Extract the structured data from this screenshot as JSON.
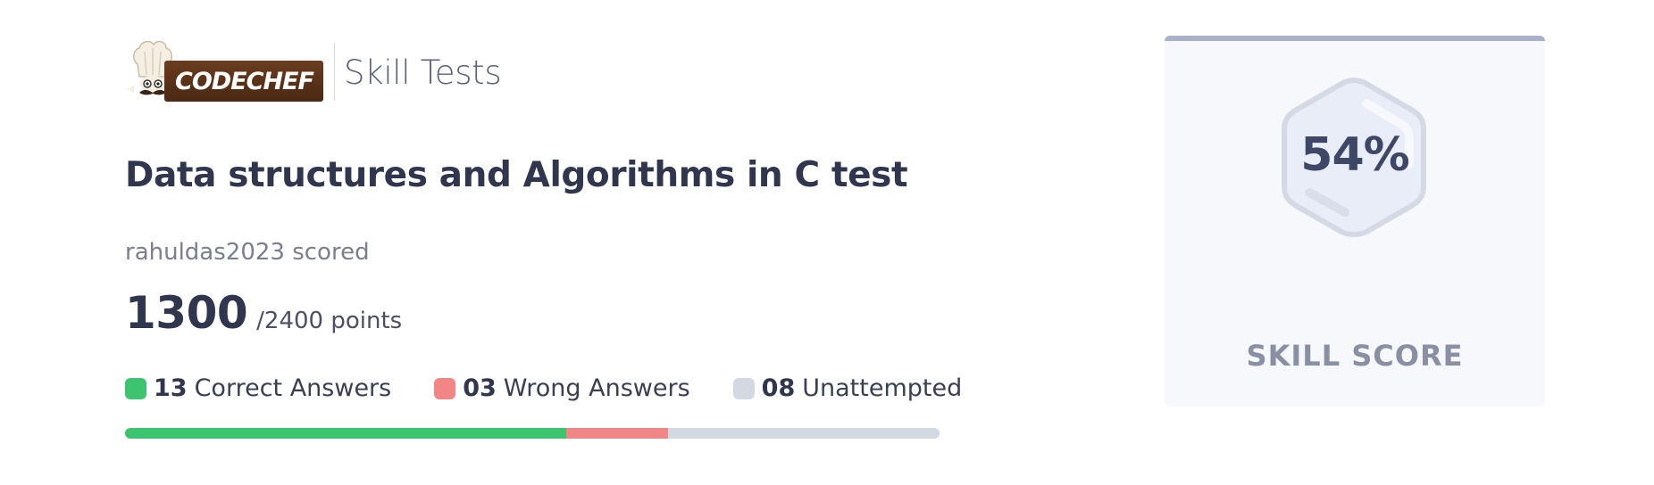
{
  "brand": {
    "logo_text": "CODECHEF",
    "product_name": "Skill Tests"
  },
  "test": {
    "title": "Data structures and Algorithms in C test",
    "scored_text": "rahuldas2023 scored",
    "score": "1300",
    "total": "/2400 points"
  },
  "legend": [
    {
      "count": "13",
      "label": "Correct Answers",
      "color": "#3cc46e"
    },
    {
      "count": "03",
      "label": "Wrong Answers",
      "color": "#f28585"
    },
    {
      "count": "08",
      "label": "Unattempted",
      "color": "#d3d9e3"
    }
  ],
  "progress": {
    "correct": 13,
    "wrong": 3,
    "unattempted": 8
  },
  "skill_card": {
    "percent": "54%",
    "label": "SKILL SCORE",
    "accent_color": "#a8b1c7"
  }
}
